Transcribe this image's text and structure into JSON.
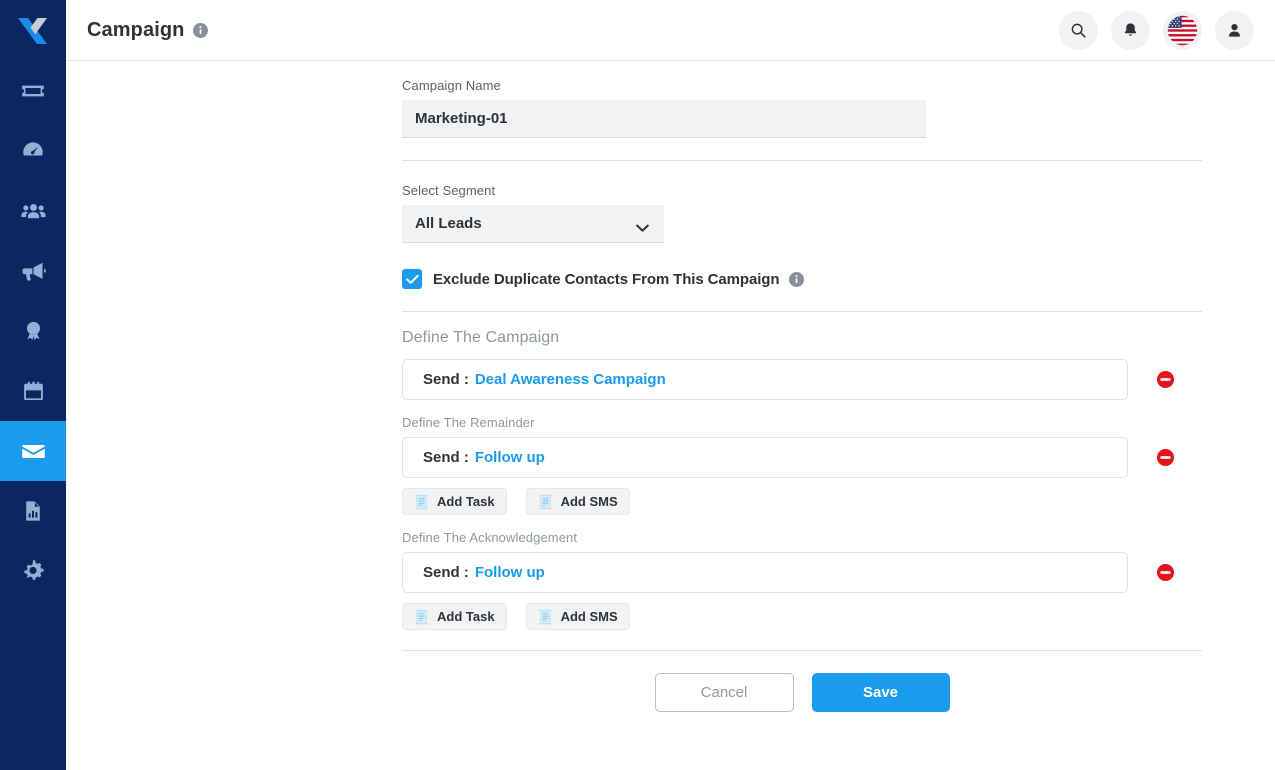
{
  "sidebar": {
    "logo_name": "x-logo",
    "items": [
      {
        "name": "tickets",
        "icon": "ticket-icon",
        "active": false
      },
      {
        "name": "dashboard",
        "icon": "speedometer-icon",
        "active": false
      },
      {
        "name": "contacts",
        "icon": "users-icon",
        "active": false
      },
      {
        "name": "marketing",
        "icon": "megaphone-icon",
        "active": false
      },
      {
        "name": "deals",
        "icon": "award-icon",
        "active": false
      },
      {
        "name": "calendar",
        "icon": "calendar-icon",
        "active": false
      },
      {
        "name": "campaign",
        "icon": "envelope-icon",
        "active": true
      },
      {
        "name": "reports",
        "icon": "report-icon",
        "active": false
      },
      {
        "name": "settings",
        "icon": "gear-icon",
        "active": false
      }
    ]
  },
  "header": {
    "title": "Campaign",
    "info_icon": "info-icon",
    "actions": [
      {
        "name": "search",
        "icon": "search-icon"
      },
      {
        "name": "notifications",
        "icon": "bell-icon"
      },
      {
        "name": "language",
        "icon": "us-flag-icon"
      },
      {
        "name": "profile",
        "icon": "user-icon"
      }
    ]
  },
  "form": {
    "campaign_name": {
      "label": "Campaign Name",
      "value": "Marketing-01",
      "placeholder": "Campaign Name"
    },
    "segment": {
      "label": "Select Segment",
      "value": "All Leads",
      "chevron": "chevron-down-icon"
    },
    "exclude_duplicates": {
      "label": "Exclude Duplicate Contacts From This Campaign",
      "checked": true,
      "info_icon": "info-icon"
    },
    "sections": [
      {
        "title": "Define The Campaign",
        "title_size": "large",
        "send_label": "Send :",
        "send_value": "Deal Awareness Campaign",
        "remove_icon": "remove-circle-icon",
        "buttons": []
      },
      {
        "title": "Define The Remainder",
        "title_size": "small",
        "send_label": "Send :",
        "send_value": "Follow up",
        "remove_icon": "remove-circle-icon",
        "buttons": [
          {
            "label": "Add Task",
            "icon": "task-document-icon"
          },
          {
            "label": "Add SMS",
            "icon": "sms-document-icon"
          }
        ]
      },
      {
        "title": "Define The Acknowledgement",
        "title_size": "small",
        "send_label": "Send :",
        "send_value": "Follow up",
        "remove_icon": "remove-circle-icon",
        "buttons": [
          {
            "label": "Add Task",
            "icon": "task-document-icon"
          },
          {
            "label": "Add SMS",
            "icon": "sms-document-icon"
          }
        ]
      }
    ],
    "footer": {
      "cancel_label": "Cancel",
      "save_label": "Save"
    }
  },
  "colors": {
    "sidebar_bg": "#0a2764",
    "accent": "#1a9bf0",
    "danger": "#e8121a",
    "muted_text": "#9097a0",
    "dark_text": "#2f3338"
  }
}
